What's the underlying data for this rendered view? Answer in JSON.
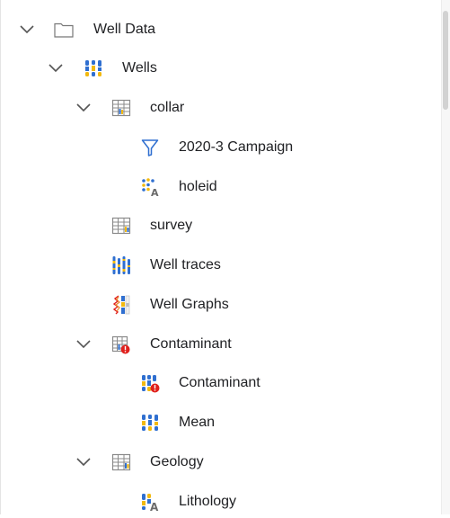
{
  "tree": {
    "well_data": {
      "label": "Well Data",
      "expanded": true,
      "icon": "folder-icon"
    },
    "wells": {
      "label": "Wells",
      "expanded": true,
      "icon": "wells-icon"
    },
    "collar": {
      "label": "collar",
      "expanded": true,
      "icon": "table-icon"
    },
    "campaign_2020_3": {
      "label": "2020-3 Campaign",
      "icon": "filter-icon"
    },
    "holeid": {
      "label": "holeid",
      "icon": "category-text-icon"
    },
    "survey": {
      "label": "survey",
      "icon": "table-icon"
    },
    "well_traces": {
      "label": "Well traces",
      "icon": "well-traces-icon"
    },
    "well_graphs": {
      "label": "Well Graphs",
      "icon": "well-graphs-icon"
    },
    "contaminant_table": {
      "label": "Contaminant",
      "expanded": true,
      "icon": "table-error-icon"
    },
    "contaminant_item": {
      "label": "Contaminant",
      "icon": "wells-error-icon"
    },
    "mean": {
      "label": "Mean",
      "icon": "wells-icon"
    },
    "geology": {
      "label": "Geology",
      "expanded": true,
      "icon": "table-icon"
    },
    "lithology": {
      "label": "Lithology",
      "icon": "lithology-icon"
    }
  },
  "colors": {
    "blue": "#2f6fd0",
    "yellow": "#f2b90f",
    "red": "#e0201c",
    "orange": "#e8892b",
    "grey": "#8a8a8a"
  }
}
